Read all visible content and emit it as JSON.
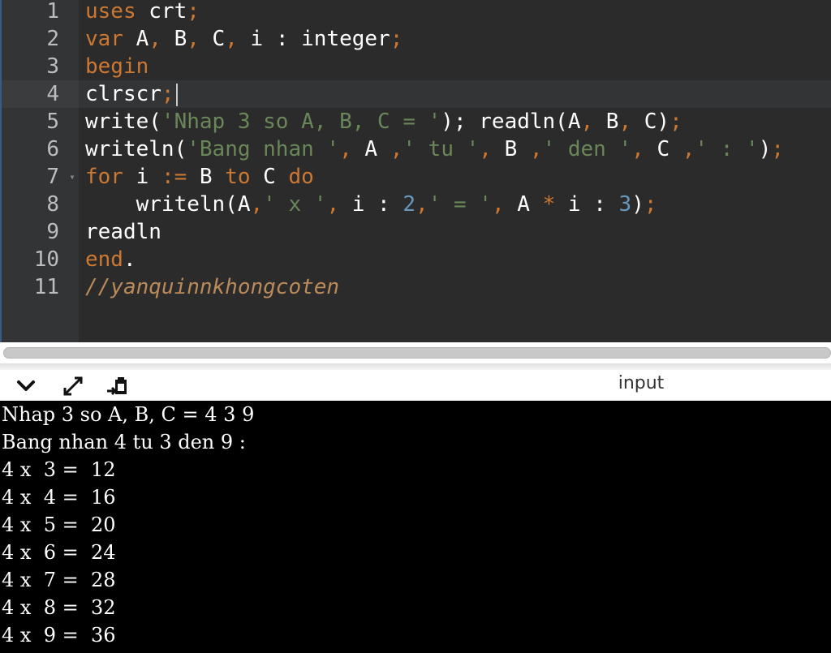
{
  "editor": {
    "lines": [
      {
        "number": "1",
        "fold": "",
        "tokens": [
          {
            "t": "uses",
            "c": "kw"
          },
          {
            "t": " crt",
            "c": "plain"
          },
          {
            "t": ";",
            "c": "punc"
          }
        ]
      },
      {
        "number": "2",
        "fold": "",
        "tokens": [
          {
            "t": "var",
            "c": "kw"
          },
          {
            "t": " A",
            "c": "plain"
          },
          {
            "t": ",",
            "c": "punc"
          },
          {
            "t": " B",
            "c": "plain"
          },
          {
            "t": ",",
            "c": "punc"
          },
          {
            "t": " C",
            "c": "plain"
          },
          {
            "t": ",",
            "c": "punc"
          },
          {
            "t": " i : integer",
            "c": "plain"
          },
          {
            "t": ";",
            "c": "punc"
          }
        ]
      },
      {
        "number": "3",
        "fold": "",
        "tokens": [
          {
            "t": "begin",
            "c": "kw"
          }
        ]
      },
      {
        "number": "4",
        "fold": "",
        "active": true,
        "tokens": [
          {
            "t": "clrscr",
            "c": "plain"
          },
          {
            "t": ";",
            "c": "punc"
          }
        ]
      },
      {
        "number": "5",
        "fold": "",
        "tokens": [
          {
            "t": "write(",
            "c": "plain"
          },
          {
            "t": "'Nhap 3 so A, B, C = '",
            "c": "str"
          },
          {
            "t": ");",
            "c": "plain"
          },
          {
            "t": " readln(A",
            "c": "plain"
          },
          {
            "t": ",",
            "c": "punc"
          },
          {
            "t": " B",
            "c": "plain"
          },
          {
            "t": ",",
            "c": "punc"
          },
          {
            "t": " C)",
            "c": "plain"
          },
          {
            "t": ";",
            "c": "punc"
          }
        ]
      },
      {
        "number": "6",
        "fold": "",
        "tokens": [
          {
            "t": "writeln(",
            "c": "plain"
          },
          {
            "t": "'Bang nhan '",
            "c": "str"
          },
          {
            "t": ",",
            "c": "punc"
          },
          {
            "t": " A ",
            "c": "plain"
          },
          {
            "t": ",",
            "c": "punc"
          },
          {
            "t": "' tu '",
            "c": "str"
          },
          {
            "t": ",",
            "c": "punc"
          },
          {
            "t": " B ",
            "c": "plain"
          },
          {
            "t": ",",
            "c": "punc"
          },
          {
            "t": "' den '",
            "c": "str"
          },
          {
            "t": ",",
            "c": "punc"
          },
          {
            "t": " C ",
            "c": "plain"
          },
          {
            "t": ",",
            "c": "punc"
          },
          {
            "t": "' : '",
            "c": "str"
          },
          {
            "t": ")",
            "c": "plain"
          },
          {
            "t": ";",
            "c": "punc"
          }
        ]
      },
      {
        "number": "7",
        "fold": "▾",
        "tokens": [
          {
            "t": "for",
            "c": "kw"
          },
          {
            "t": " i ",
            "c": "plain"
          },
          {
            "t": ":=",
            "c": "punc"
          },
          {
            "t": " B ",
            "c": "plain"
          },
          {
            "t": "to",
            "c": "kw"
          },
          {
            "t": " C ",
            "c": "plain"
          },
          {
            "t": "do",
            "c": "kw"
          }
        ]
      },
      {
        "number": "8",
        "fold": "",
        "tokens": [
          {
            "t": "    writeln(A",
            "c": "plain"
          },
          {
            "t": ",",
            "c": "punc"
          },
          {
            "t": "' x '",
            "c": "str"
          },
          {
            "t": ",",
            "c": "punc"
          },
          {
            "t": " i : ",
            "c": "plain"
          },
          {
            "t": "2",
            "c": "num"
          },
          {
            "t": ",",
            "c": "punc"
          },
          {
            "t": "' = '",
            "c": "str"
          },
          {
            "t": ",",
            "c": "punc"
          },
          {
            "t": " A ",
            "c": "plain"
          },
          {
            "t": "*",
            "c": "punc"
          },
          {
            "t": " i : ",
            "c": "plain"
          },
          {
            "t": "3",
            "c": "num"
          },
          {
            "t": ")",
            "c": "plain"
          },
          {
            "t": ";",
            "c": "punc"
          }
        ]
      },
      {
        "number": "9",
        "fold": "",
        "tokens": [
          {
            "t": "readln",
            "c": "plain"
          }
        ]
      },
      {
        "number": "10",
        "fold": "",
        "tokens": [
          {
            "t": "end",
            "c": "kw"
          },
          {
            "t": ".",
            "c": "plain"
          }
        ]
      },
      {
        "number": "11",
        "fold": "",
        "tokens": [
          {
            "t": "//yanquinnkhongcoten",
            "c": "cm"
          }
        ]
      }
    ]
  },
  "toolbar": {
    "collapse_icon": "chevron-down-icon",
    "expand_icon": "expand-arrows-icon",
    "clear_icon": "clear-console-icon",
    "input_label": "input"
  },
  "console": {
    "lines": [
      "Nhap 3 so A, B, C = 4 3 9",
      "Bang nhan 4 tu 3 den 9 :",
      "4 x  3 =  12",
      "4 x  4 =  16",
      "4 x  5 =  20",
      "4 x  6 =  24",
      "4 x  7 =  28",
      "4 x  8 =  32",
      "4 x  9 =  36"
    ]
  },
  "colors": {
    "editor_bg": "#2b2b2b",
    "keyword": "#cc7832",
    "string": "#6a8759",
    "number": "#6897bb",
    "comment": "#bb8a5a",
    "console_bg": "#000000"
  }
}
